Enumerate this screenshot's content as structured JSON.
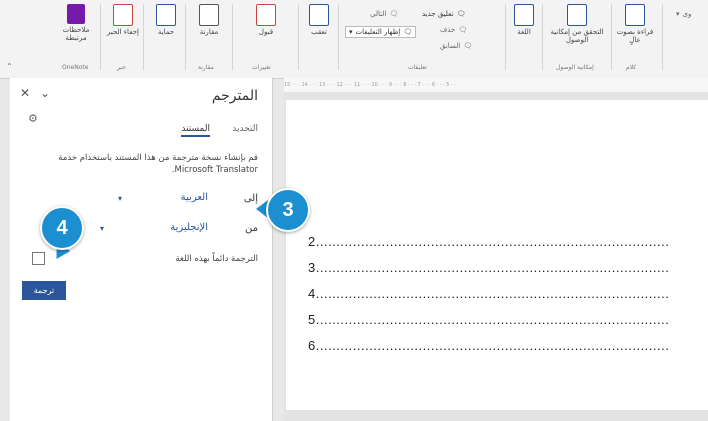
{
  "ribbon": {
    "onenote": {
      "label": "ملاحظات مرتبطة",
      "group": "OneNote"
    },
    "ink": {
      "label": "إخفاء الحبر",
      "group": "حبر"
    },
    "protect": {
      "label": "حماية"
    },
    "compare": {
      "label": "مقارنة",
      "group": "مقارنة"
    },
    "changes": {
      "accept": "قبول",
      "group": "تغييرات"
    },
    "track": {
      "label": "تعقب"
    },
    "comments": {
      "new": "تعليق جديد",
      "delete": "حذف",
      "previous": "السابق",
      "next": "التالي",
      "show": "إظهار التعليقات",
      "group": "تعليقات"
    },
    "language": {
      "label": "اللغة"
    },
    "accessibility": {
      "label": "التحقق من إمكانية الوصول",
      "group": "إمكانية الوصول"
    },
    "read_aloud": {
      "label": "قراءة بصوت عالٍ",
      "group": "كلام"
    },
    "overflow": "وى"
  },
  "ruler": "15 · · · 14 · · · 13 · · · 12 · · · 11 · · · 10 · · · 9 · · · 8 · · · 7 · · · 6 · · · 5 · ·",
  "pane": {
    "title": "المترجم",
    "tab_selection": "التحديد",
    "tab_document": "المستند",
    "description": "قم بإنشاء نسخة مترجمة من هذا المستند باستخدام خدمة Microsoft Translator.",
    "to_label": "إلى",
    "to_value": "العربية",
    "from_label": "من",
    "from_value": "الإنجليزية",
    "always_translate": "الترجمة دائماً بهذه اللغة",
    "translate_button": "ترجمة"
  },
  "document": {
    "lines": [
      "2......................................................................................",
      "3......................................................................................",
      "4......................................................................................",
      "5......................................................................................",
      "6......................................................................................"
    ]
  },
  "callouts": {
    "three": "3",
    "four": "4"
  },
  "colors": {
    "accent": "#2b579a",
    "callout": "#1c8fd0"
  }
}
